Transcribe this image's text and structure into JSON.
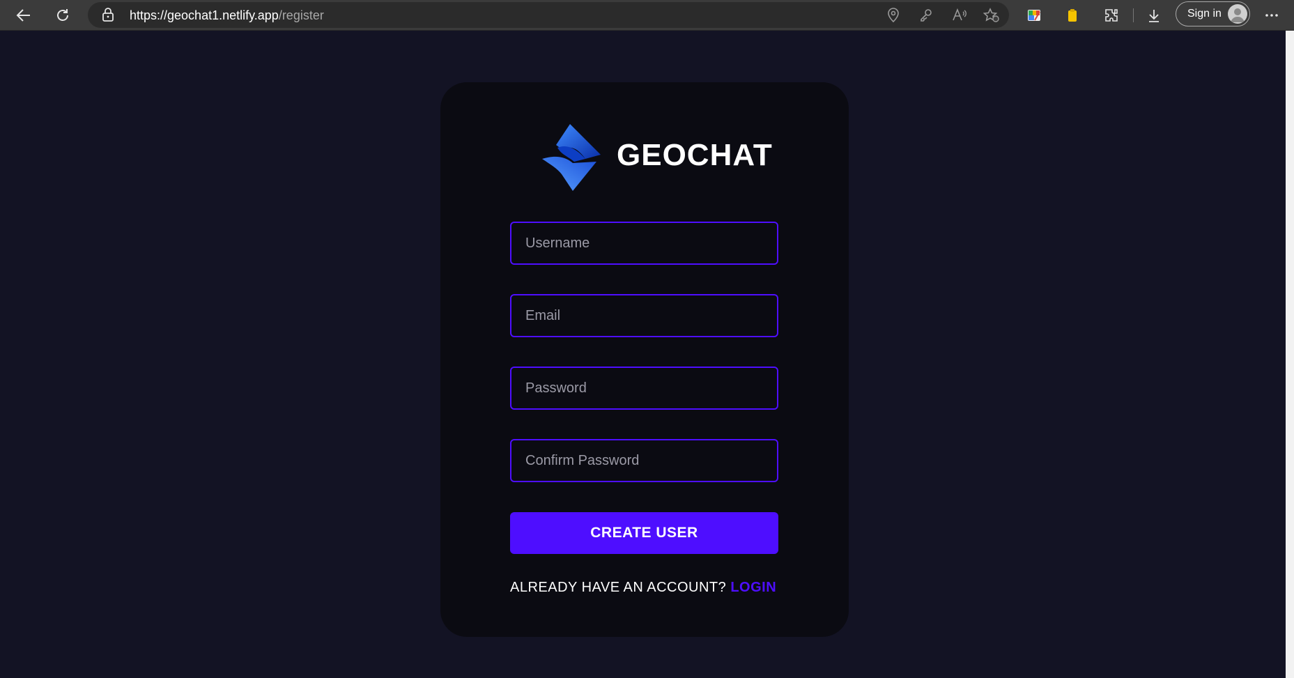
{
  "browser": {
    "url_host": "https://geochat1.netlify.app",
    "url_path": "/register",
    "signin_label": "Sign in",
    "icons": [
      "back-icon",
      "refresh-icon",
      "lock-icon",
      "location-icon",
      "key-icon",
      "read-aloud-icon",
      "favorites-icon",
      "extension-colorful-icon",
      "extension-yellow-icon",
      "extensions-icon",
      "download-icon",
      "more-icon"
    ]
  },
  "brand": {
    "name": "geochat",
    "logo": "geochat-logo-icon"
  },
  "form": {
    "username_placeholder": "Username",
    "email_placeholder": "Email",
    "password_placeholder": "Password",
    "confirm_placeholder": "Confirm Password",
    "submit_label": "Create User",
    "footer_text": "Already have an account? ",
    "footer_link": "Login"
  },
  "colors": {
    "background": "#131324",
    "card": "#0b0b12",
    "accent": "#4e0eff"
  }
}
